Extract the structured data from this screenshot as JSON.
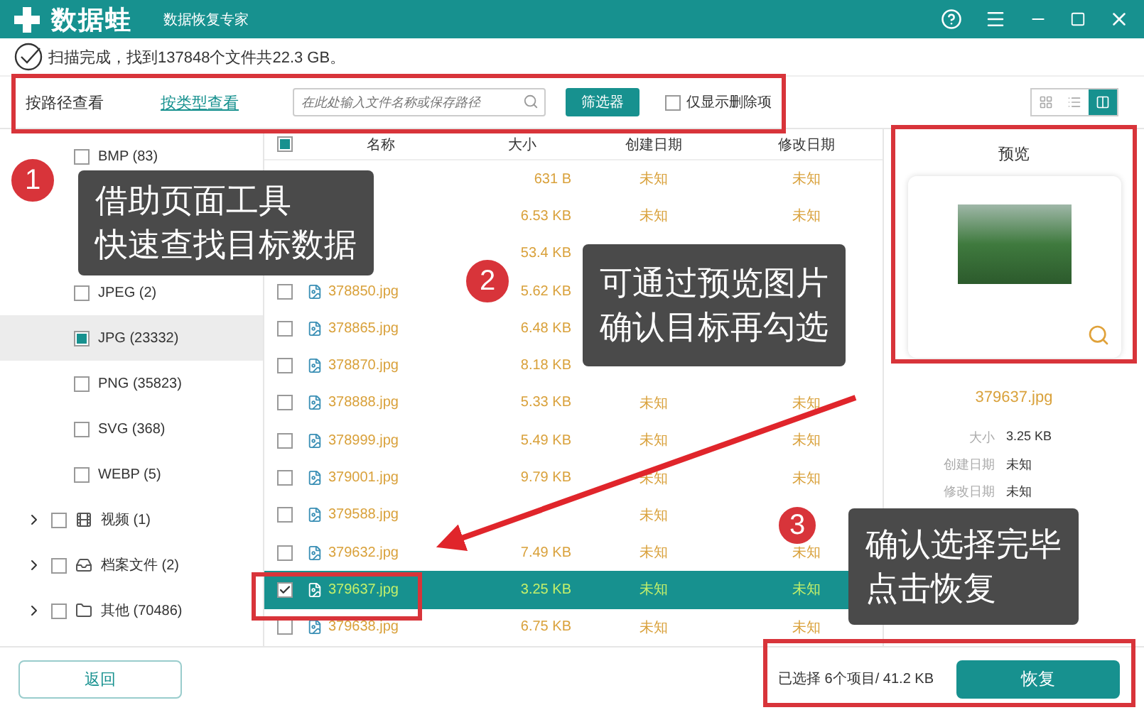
{
  "title_bar": {
    "app_name": "数据蛙",
    "subtitle": "数据恢复专家"
  },
  "scan_status": "扫描完成，找到137848个文件共22.3 GB。",
  "view_tabs": [
    {
      "label": "按路径查看",
      "selected": false
    },
    {
      "label": "按类型查看",
      "selected": true
    }
  ],
  "search": {
    "placeholder": "在此处输入文件名称或保存路径"
  },
  "filter_button": "筛选器",
  "deleted_only": {
    "label": "仅显示删除项",
    "checked": false
  },
  "view_modes": [
    {
      "kind": "grid",
      "selected": false
    },
    {
      "kind": "list",
      "selected": false
    },
    {
      "kind": "detail",
      "selected": true
    }
  ],
  "type_list": [
    {
      "label": "BMP (83)",
      "checked": false,
      "partial": false,
      "selected": false
    },
    {
      "selected": false
    },
    {
      "selected": false
    },
    {
      "label": "JPEG (2)",
      "checked": false,
      "partial": false,
      "selected": false
    },
    {
      "label": "JPG (23332)",
      "checked": false,
      "partial": true,
      "selected": true
    },
    {
      "label": "PNG (35823)",
      "checked": false,
      "partial": false,
      "selected": false
    },
    {
      "label": "SVG (368)",
      "checked": false,
      "partial": false,
      "selected": false
    },
    {
      "label": "WEBP (5)",
      "checked": false,
      "partial": false,
      "selected": false
    }
  ],
  "categories": [
    {
      "kind": "video",
      "label": "视频 (1)",
      "checked": false,
      "expanded": false
    },
    {
      "kind": "archive",
      "label": "档案文件 (2)",
      "checked": false,
      "expanded": false
    },
    {
      "kind": "folder",
      "label": "其他 (70486)",
      "checked": false,
      "expanded": false
    }
  ],
  "table": {
    "header_partial": true,
    "columns": [
      "名称",
      "大小",
      "创建日期",
      "修改日期"
    ],
    "rows": [
      {
        "selected": false,
        "size": "631 B",
        "created": "未知",
        "modified": "未知"
      },
      {
        "selected": false,
        "size": "6.53 KB",
        "created": "未知",
        "modified": "未知"
      },
      {
        "selected": false,
        "size": "53.4 KB"
      },
      {
        "checked": false,
        "selected": false,
        "name": "378850.jpg",
        "size": "5.62 KB"
      },
      {
        "checked": false,
        "selected": false,
        "name": "378865.jpg",
        "size": "6.48 KB"
      },
      {
        "checked": false,
        "selected": false,
        "name": "378870.jpg",
        "size": "8.18 KB"
      },
      {
        "checked": false,
        "selected": false,
        "name": "378888.jpg",
        "size": "5.33 KB",
        "created": "未知",
        "modified": "未知"
      },
      {
        "checked": false,
        "selected": false,
        "name": "378999.jpg",
        "size": "5.49 KB",
        "created": "未知",
        "modified": "未知"
      },
      {
        "checked": false,
        "selected": false,
        "name": "379001.jpg",
        "size": "9.79 KB",
        "created": "未知",
        "modified": "未知"
      },
      {
        "checked": false,
        "selected": false,
        "name": "379588.jpg",
        "created": "未知"
      },
      {
        "checked": false,
        "selected": false,
        "name": "379632.jpg",
        "size": "7.49 KB",
        "created": "未知",
        "modified": "未知"
      },
      {
        "checked": true,
        "selected": true,
        "name": "379637.jpg",
        "size": "3.25 KB",
        "created": "未知",
        "modified": "未知"
      },
      {
        "checked": false,
        "selected": false,
        "name": "379638.jpg",
        "size": "6.75 KB",
        "created": "未知",
        "modified": "未知"
      }
    ]
  },
  "preview": {
    "title": "预览",
    "file_name": "379637.jpg",
    "details": [
      {
        "label": "大小",
        "value": "3.25 KB"
      },
      {
        "label": "创建日期",
        "value": "未知"
      },
      {
        "label": "修改日期",
        "value": "未知"
      }
    ]
  },
  "footer": {
    "back_button": "返回",
    "selection_summary": "已选择 6个项目/ 41.2 KB",
    "recover_button": "恢复"
  },
  "annotations": [
    {
      "number": "1",
      "lines": [
        "借助页面工具",
        "快速查找目标数据"
      ]
    },
    {
      "number": "2",
      "lines": [
        "可通过预览图片",
        "确认目标再勾选"
      ]
    },
    {
      "number": "3",
      "lines": [
        "确认选择完毕",
        "点击恢复"
      ]
    }
  ]
}
